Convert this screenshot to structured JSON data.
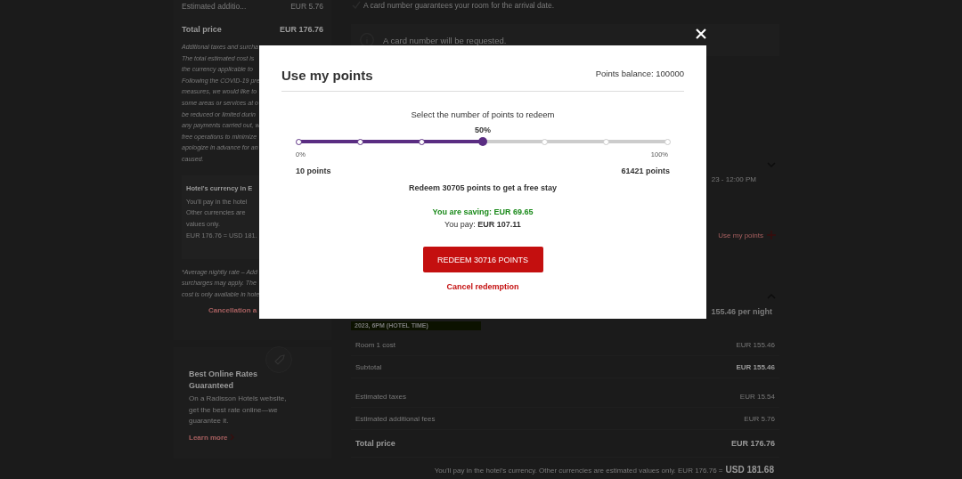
{
  "background": {
    "left": {
      "fees_row": {
        "label": "Estimated additio...",
        "value": "EUR 5.76"
      },
      "total_row": {
        "label": "Total price",
        "value": "EUR 176.76"
      },
      "disclaimer_lines": [
        "Additional taxes and surcha",
        "The total estimated cost is",
        "the currency applicable to",
        "Following the COVID-19 pre",
        "measures, we would like to",
        "some areas or services at o",
        "be reduced or limited durin",
        "any payments carried out, w",
        "free operations to minimize",
        "apologize in advance for an",
        "caused."
      ],
      "currency_note": {
        "title": "Hotel's currency in E",
        "lines": [
          "You'll pay in the hotel",
          "Other currencies are",
          "values only.",
          "EUR 176.76 = USD 181."
        ]
      },
      "nightly_note_lines": [
        "*Average nightly rate – Add",
        "surcharges may apply. The",
        "cost is only available in hote"
      ],
      "cancellation_link": "Cancellation a",
      "rates_card": {
        "title": "Best Online Rates Guaranteed",
        "text": "On a Radisson Hotels website, get the best rate online—we guarantee it.",
        "link": "Learn more"
      }
    },
    "main": {
      "guarantee_note": "A card number guarantees your room for the arrival date.",
      "card_notice": "A card number will be requested.",
      "time_text": "23 - 12:00 PM",
      "use_points_link": "Use my points",
      "nightly_rate": "155.46 per night",
      "deadline_banner": "2023, 6PM (HOTEL TIME)",
      "price_rows": [
        {
          "kind": "normal",
          "label": "Room 1 cost",
          "value": "EUR 155.46"
        },
        {
          "kind": "subtotal",
          "label": "Subtotal",
          "value": "EUR 155.46"
        },
        {
          "kind": "normal",
          "label": "Estimated taxes",
          "value": "EUR 15.54"
        },
        {
          "kind": "normal",
          "label": "Estimated additional fees",
          "value": "EUR 5.76"
        },
        {
          "kind": "total",
          "label": "Total price",
          "value": "EUR 176.76"
        }
      ],
      "currency_footer": {
        "text": "You'll pay in the hotel's currency. Other currencies are estimated values only. EUR 176.76 =",
        "amount": "USD 181.68"
      }
    }
  },
  "modal": {
    "title": "Use my points",
    "balance": "Points balance: 100000",
    "prompt": "Select the number of points to redeem",
    "slider": {
      "value_label": "50%",
      "level": 0.5,
      "min_label": "0%",
      "max_label": "100%",
      "min_points": "10 points",
      "max_points": "61421 points"
    },
    "redeem_summary": "Redeem 30705 points to get a free stay",
    "saving": "You are saving: EUR 69.65",
    "pay_label": "You pay:",
    "pay_amount": "EUR 107.11",
    "redeem_button": "REDEEM 30716 POINTS",
    "cancel_link": "Cancel redemption"
  }
}
